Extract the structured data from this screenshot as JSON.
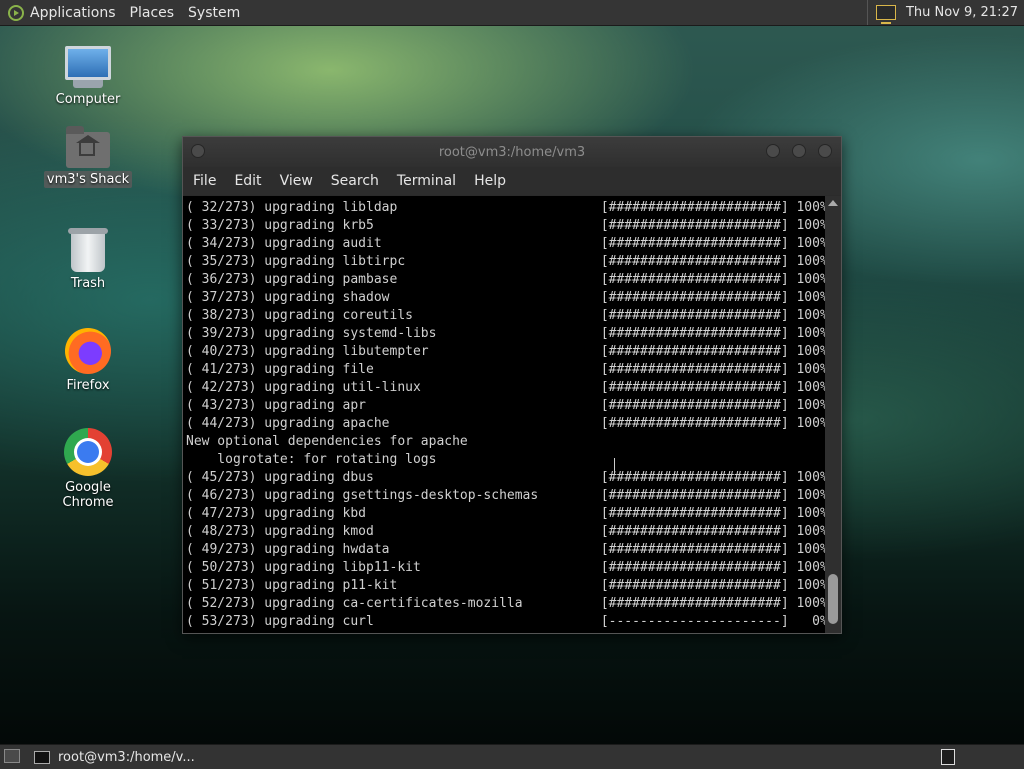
{
  "top_panel": {
    "menus": [
      "Applications",
      "Places",
      "System"
    ],
    "clock": "Thu Nov  9, 21:27",
    "icons": [
      "distro-menu-icon",
      "display-icon"
    ]
  },
  "desktop": {
    "icons": [
      {
        "label": "Computer",
        "icon": "computer-icon"
      },
      {
        "label": "vm3's Shack",
        "icon": "home-folder-icon"
      },
      {
        "label": "Trash",
        "icon": "trash-icon"
      },
      {
        "label": "Firefox",
        "icon": "firefox-icon"
      },
      {
        "label": "Google Chrome",
        "icon": "chrome-icon"
      }
    ]
  },
  "terminal": {
    "title": "root@vm3:/home/vm3",
    "menu": [
      "File",
      "Edit",
      "View",
      "Search",
      "Terminal",
      "Help"
    ],
    "lines": [
      "( 32/273) upgrading libldap                          [######################] 100%",
      "( 33/273) upgrading krb5                             [######################] 100%",
      "( 34/273) upgrading audit                            [######################] 100%",
      "( 35/273) upgrading libtirpc                         [######################] 100%",
      "( 36/273) upgrading pambase                          [######################] 100%",
      "( 37/273) upgrading shadow                           [######################] 100%",
      "( 38/273) upgrading coreutils                        [######################] 100%",
      "( 39/273) upgrading systemd-libs                     [######################] 100%",
      "( 40/273) upgrading libutempter                      [######################] 100%",
      "( 41/273) upgrading file                             [######################] 100%",
      "( 42/273) upgrading util-linux                       [######################] 100%",
      "( 43/273) upgrading apr                              [######################] 100%",
      "( 44/273) upgrading apache                           [######################] 100%",
      "New optional dependencies for apache",
      "    logrotate: for rotating logs",
      "( 45/273) upgrading dbus                             [######################] 100%",
      "( 46/273) upgrading gsettings-desktop-schemas        [######################] 100%",
      "( 47/273) upgrading kbd                              [######################] 100%",
      "( 48/273) upgrading kmod                             [######################] 100%",
      "( 49/273) upgrading hwdata                           [######################] 100%",
      "( 50/273) upgrading libp11-kit                       [######################] 100%",
      "( 51/273) upgrading p11-kit                          [######################] 100%",
      "( 52/273) upgrading ca-certificates-mozilla          [######################] 100%",
      "( 53/273) upgrading curl                             [----------------------]   0%"
    ]
  },
  "bottom_panel": {
    "task_label": "root@vm3:/home/v..."
  },
  "colors": {
    "panel": "#353535",
    "terminal_bg": "#000000",
    "terminal_text": "#d0d0d0",
    "mint_accent": "#8ab34a"
  }
}
